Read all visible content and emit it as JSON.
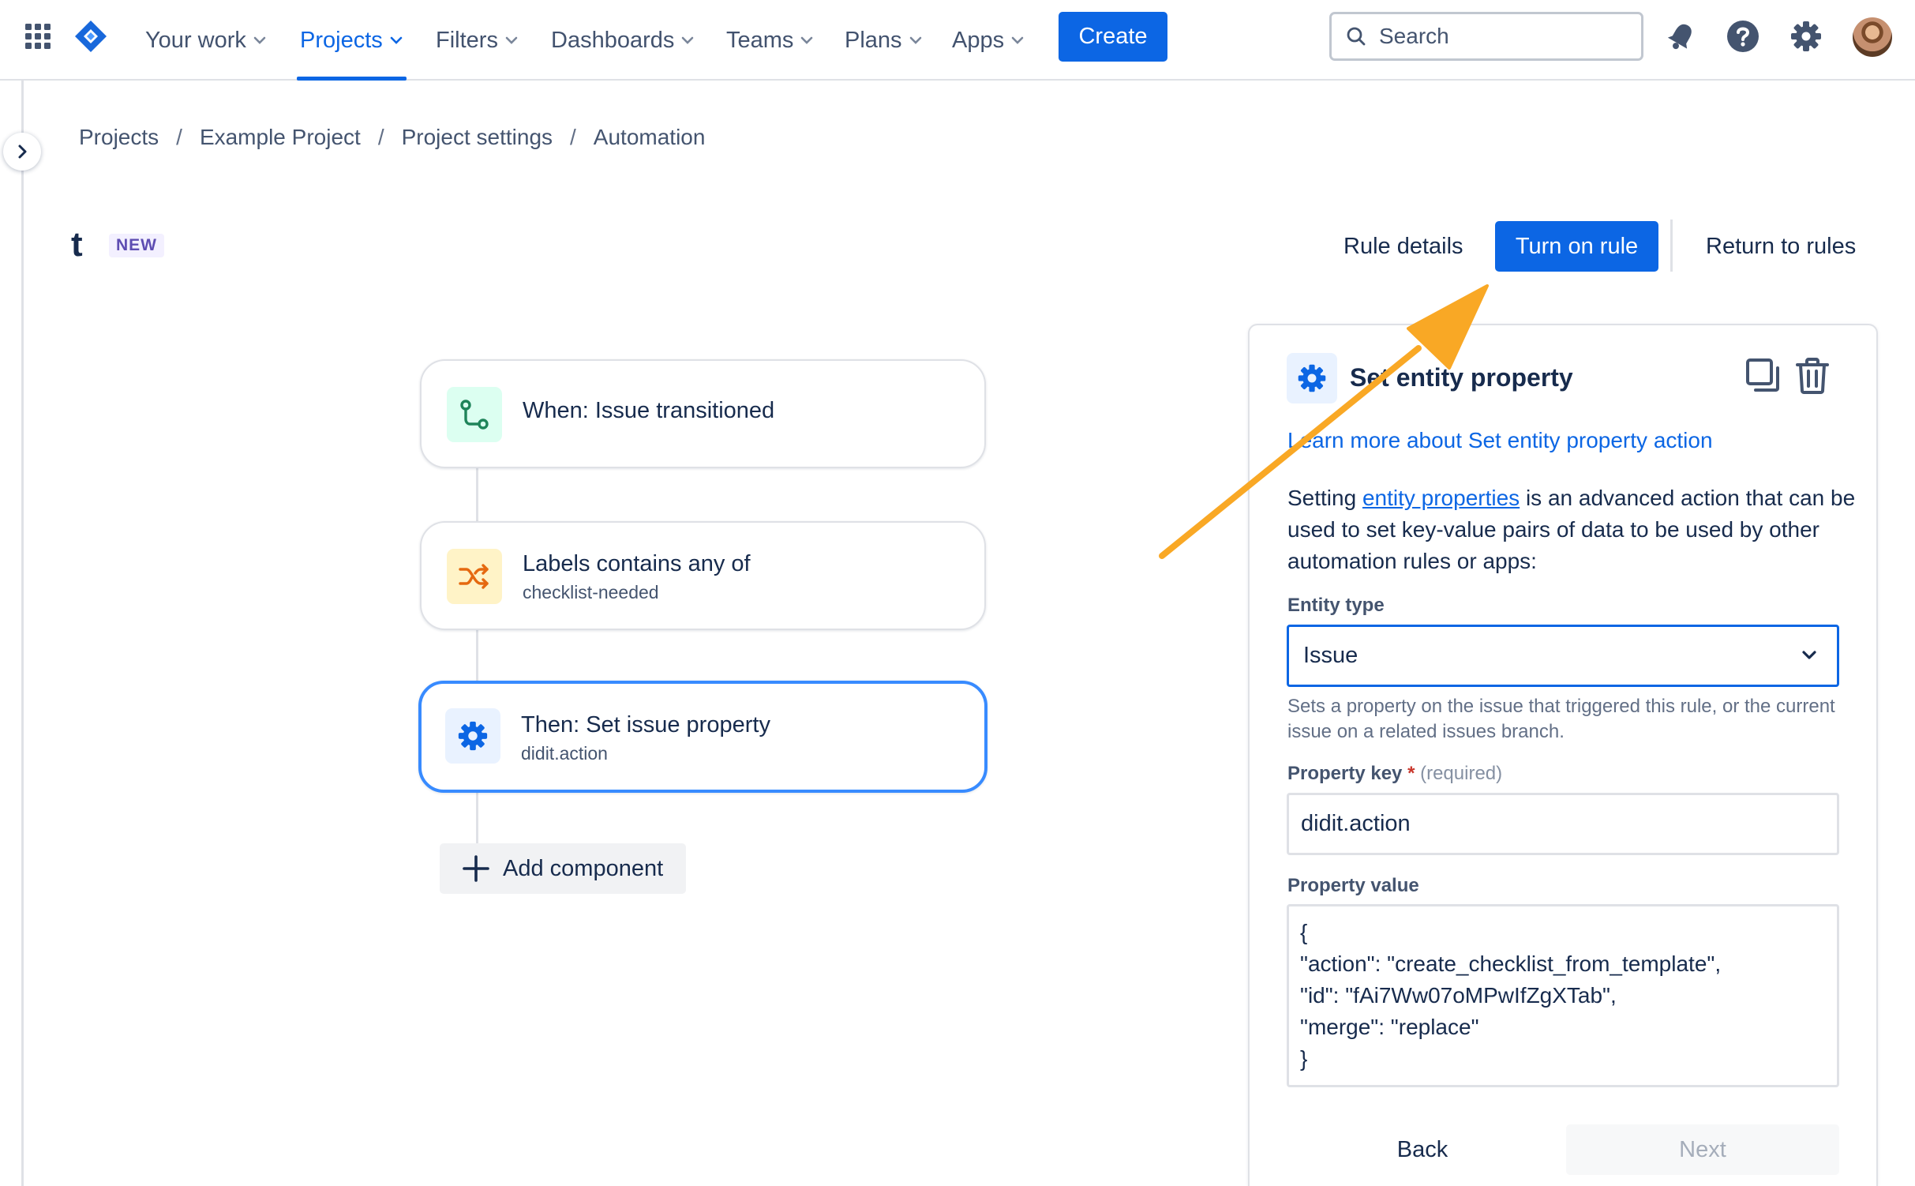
{
  "topnav": {
    "items": [
      {
        "label": "Your work"
      },
      {
        "label": "Projects"
      },
      {
        "label": "Filters"
      },
      {
        "label": "Dashboards"
      },
      {
        "label": "Teams"
      },
      {
        "label": "Plans"
      },
      {
        "label": "Apps"
      }
    ],
    "active_item": "Projects",
    "create_label": "Create",
    "search_placeholder": "Search",
    "icons": [
      "app-switcher-icon",
      "jira-logo-icon",
      "notifications-icon",
      "help-icon",
      "settings-icon",
      "avatar"
    ]
  },
  "breadcrumb": [
    "Projects",
    "Example Project",
    "Project settings",
    "Automation"
  ],
  "rule": {
    "title": "t",
    "badge": "NEW",
    "actions": {
      "details_label": "Rule details",
      "turn_on_label": "Turn on rule",
      "return_label": "Return to rules"
    }
  },
  "flow": {
    "components": [
      {
        "title": "When: Issue transitioned",
        "subtitle": "",
        "icon": "transition-icon",
        "color": "#1F845A"
      },
      {
        "title": "Labels contains any of",
        "subtitle": "checklist-needed",
        "icon": "shuffle-icon",
        "color": "#E56910"
      },
      {
        "title": "Then: Set issue property",
        "subtitle": "didit.action",
        "icon": "gear-icon",
        "color": "#0C66E4"
      }
    ],
    "add_label": "Add component"
  },
  "panel": {
    "title": "Set entity property",
    "learn_more": "Learn more about Set entity property action",
    "description_before": "Setting ",
    "description_link": "entity properties",
    "description_after": " is an advanced action that can be used to set key-value pairs of data to be used by other automation rules or apps:",
    "entity_type_label": "Entity type",
    "entity_type_value": "Issue",
    "entity_type_helper": "Sets a property on the issue that triggered this rule, or the current issue on a related issues branch.",
    "property_key_label": "Property key",
    "property_key_required_mark": "*",
    "property_key_required_hint": "(required)",
    "property_key_value": "didit.action",
    "property_value_label": "Property value",
    "property_value": "{\n\"action\": \"create_checklist_from_template\",\n\"id\": \"fAi7Ww07oMPwIfZgXTab\",\n\"merge\": \"replace\"\n}",
    "back_label": "Back",
    "next_label": "Next"
  },
  "annotation": {
    "type": "arrow",
    "color": "#F9A825"
  },
  "colors": {
    "brand": "#0C66E4",
    "text": "#172B4D",
    "border": "#DFE1E6"
  }
}
